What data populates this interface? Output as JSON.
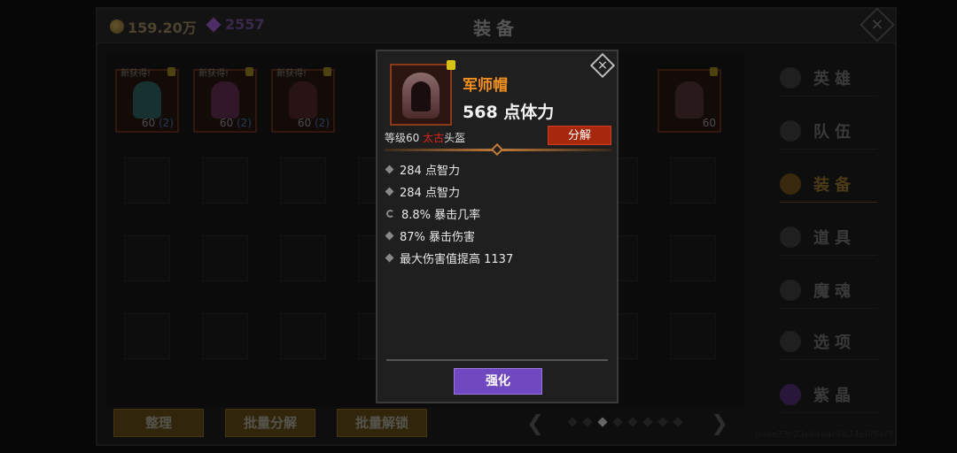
{
  "header": {
    "gold": "159.20万",
    "gems": "2557",
    "title": "装备",
    "close_icon": "close-icon"
  },
  "inventory": {
    "items": [
      {
        "tag": "新获得!",
        "level": "60",
        "count": "(2)",
        "icon": "boots-icon",
        "color": "#2a6a6a"
      },
      {
        "tag": "新获得!",
        "level": "60",
        "count": "(2)",
        "icon": "mask-icon",
        "color": "#6a2a5a"
      },
      {
        "tag": "新获得!",
        "level": "60",
        "count": "(2)",
        "icon": "robe-icon",
        "color": "#5a2a2a"
      },
      {
        "tag": "",
        "level": "60",
        "count": "",
        "icon": "hood-icon",
        "color": "#4a3030"
      }
    ]
  },
  "sidebar": {
    "items": [
      {
        "label": "英雄",
        "icon": "hero-icon"
      },
      {
        "label": "队伍",
        "icon": "flag-icon"
      },
      {
        "label": "装备",
        "icon": "helmet-icon",
        "active": true
      },
      {
        "label": "道具",
        "icon": "bag-icon"
      },
      {
        "label": "魔魂",
        "icon": "flame-icon"
      },
      {
        "label": "选项",
        "icon": "gear-icon"
      },
      {
        "label": "紫晶",
        "icon": "crystal-icon"
      }
    ]
  },
  "bottom_buttons": {
    "sort": "整理",
    "batch_decompose": "批量分解",
    "batch_unlock": "批量解锁"
  },
  "pager": {
    "pages": 8,
    "current": 3
  },
  "footer_id": "0abe73c23c8ab4c6b74e0f5af3",
  "popup": {
    "name": "军师帽",
    "main_stat": "568 点体力",
    "level": "等级60",
    "quality": "太古",
    "slot": "头盔",
    "decompose": "分解",
    "stats": [
      {
        "text": "284 点智力",
        "bullet": "diamond"
      },
      {
        "text": "284 点智力",
        "bullet": "diamond"
      },
      {
        "text": "8.8% 暴击几率",
        "bullet": "reroll"
      },
      {
        "text": "87% 暴击伤害",
        "bullet": "diamond"
      },
      {
        "text": "最大伤害值提高 1137",
        "bullet": "diamond"
      }
    ],
    "enhance": "强化",
    "colors": {
      "name": "#f39020",
      "quality": "#e0201a",
      "decompose": "#a8280e",
      "enhance": "#7048c0"
    }
  }
}
